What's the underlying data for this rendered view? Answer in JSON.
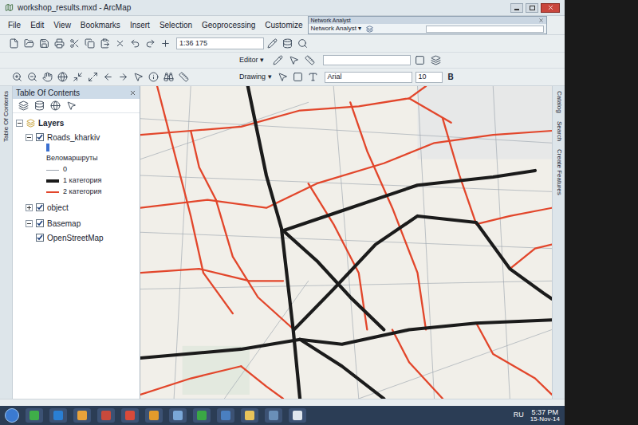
{
  "window": {
    "title": "workshop_results.mxd - ArcMap"
  },
  "menu": [
    "File",
    "Edit",
    "View",
    "Bookmarks",
    "Insert",
    "Selection",
    "Geoprocessing",
    "Customize"
  ],
  "network_analyst": {
    "title": "Network Analyst",
    "dropdown": "Network Analyst ▾"
  },
  "toolbar": {
    "scale": "1:36 175",
    "editor": "Editor ▾",
    "drawing": "Drawing ▾",
    "font": "Arial",
    "size": "10",
    "bold": "B"
  },
  "side_tabs_left": [
    "Table Of Contents"
  ],
  "side_tabs_right": [
    "Catalog",
    "Search",
    "Create Features"
  ],
  "toc": {
    "title": "Table Of Contents",
    "root": {
      "label": "Layers",
      "expanded": true,
      "layers": [
        {
          "label": "Roads_kharkiv",
          "checked": true,
          "expanded": true,
          "legend": {
            "heading": "Веломаршруты",
            "classes": [
              {
                "label": "0",
                "color": "#9aa3ad"
              },
              {
                "label": "1 категория",
                "color": "#1b1b1b"
              },
              {
                "label": "2 категория",
                "color": "#e2462b"
              }
            ]
          }
        },
        {
          "label": "object",
          "checked": true,
          "expanded": false
        },
        {
          "label": "Basemap",
          "checked": true,
          "expanded": true,
          "children": [
            {
              "label": "OpenStreetMap",
              "checked": true
            }
          ]
        }
      ]
    }
  },
  "taskbar": {
    "language": "RU",
    "time": "5:37 PM",
    "date": "15-Nov-14"
  }
}
